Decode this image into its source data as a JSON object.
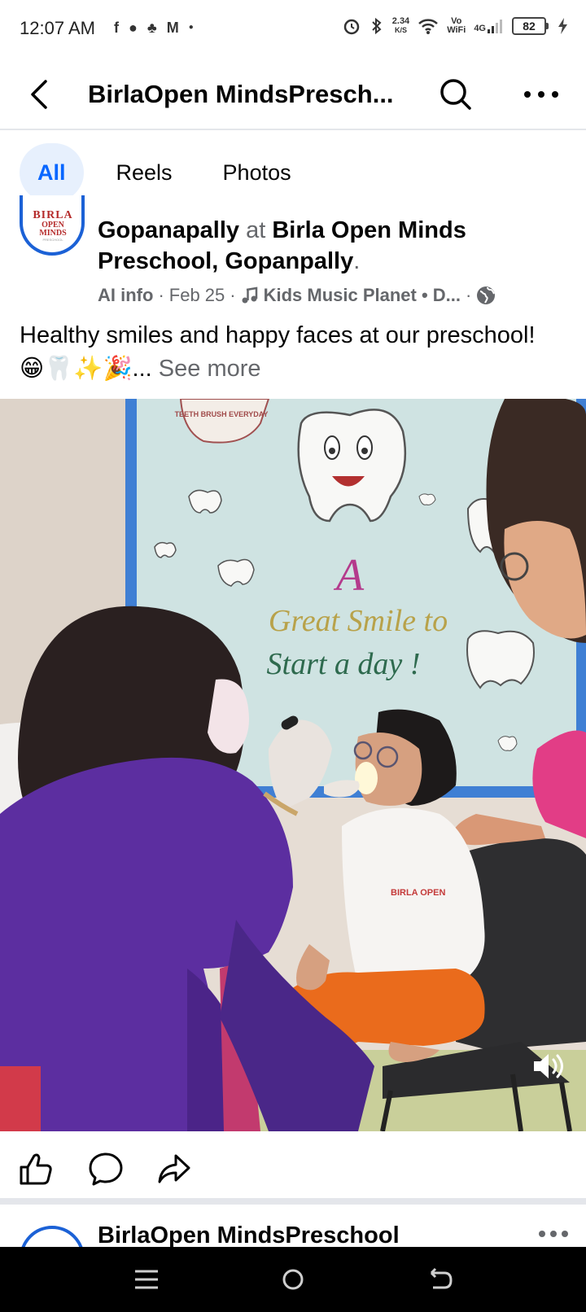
{
  "status_bar": {
    "time": "12:07 AM",
    "left_icons": [
      "facebook-icon",
      "messenger-icon",
      "snapchat-icon",
      "gmail-icon",
      "dot-icon"
    ],
    "speed_value": "2.34",
    "speed_unit": "K/S",
    "volte": "Vo",
    "wifi_label": "WiFi",
    "network": "4G",
    "battery": "82"
  },
  "header": {
    "title": "BirlaOpen MindsPresch..."
  },
  "tabs": [
    {
      "label": "All",
      "active": true
    },
    {
      "label": "Reels",
      "active": false
    },
    {
      "label": "Photos",
      "active": false
    }
  ],
  "post": {
    "avatar_text_1": "BIRLA",
    "avatar_text_2": "OPEN MINDS",
    "avatar_text_3": "PRESCHOOL",
    "author": "Gopanapally",
    "at": " at ",
    "place": "Birla Open Minds Preschool, Gopanpally",
    "period": ".",
    "meta_ai": "AI info",
    "meta_date": "Feb 25",
    "meta_music": "Kids Music Planet • D...",
    "sep": "·",
    "caption": "Healthy smiles and happy faces at our preschool! 😁🦷✨🎉...",
    "see_more": "See more"
  },
  "media": {
    "poster_line_1": "A",
    "poster_line_2": "Great Smile to",
    "poster_line_3": "Start a day !",
    "poster_badge": "TEETH BRUSH EVERYDAY",
    "shirt_logo": "BIRLA OPEN"
  },
  "next_post": {
    "title": "BirlaOpen MindsPreschool"
  },
  "colors": {
    "accent": "#0866ff",
    "tab_active_bg": "#e7f0fd",
    "muted": "#65676b"
  }
}
